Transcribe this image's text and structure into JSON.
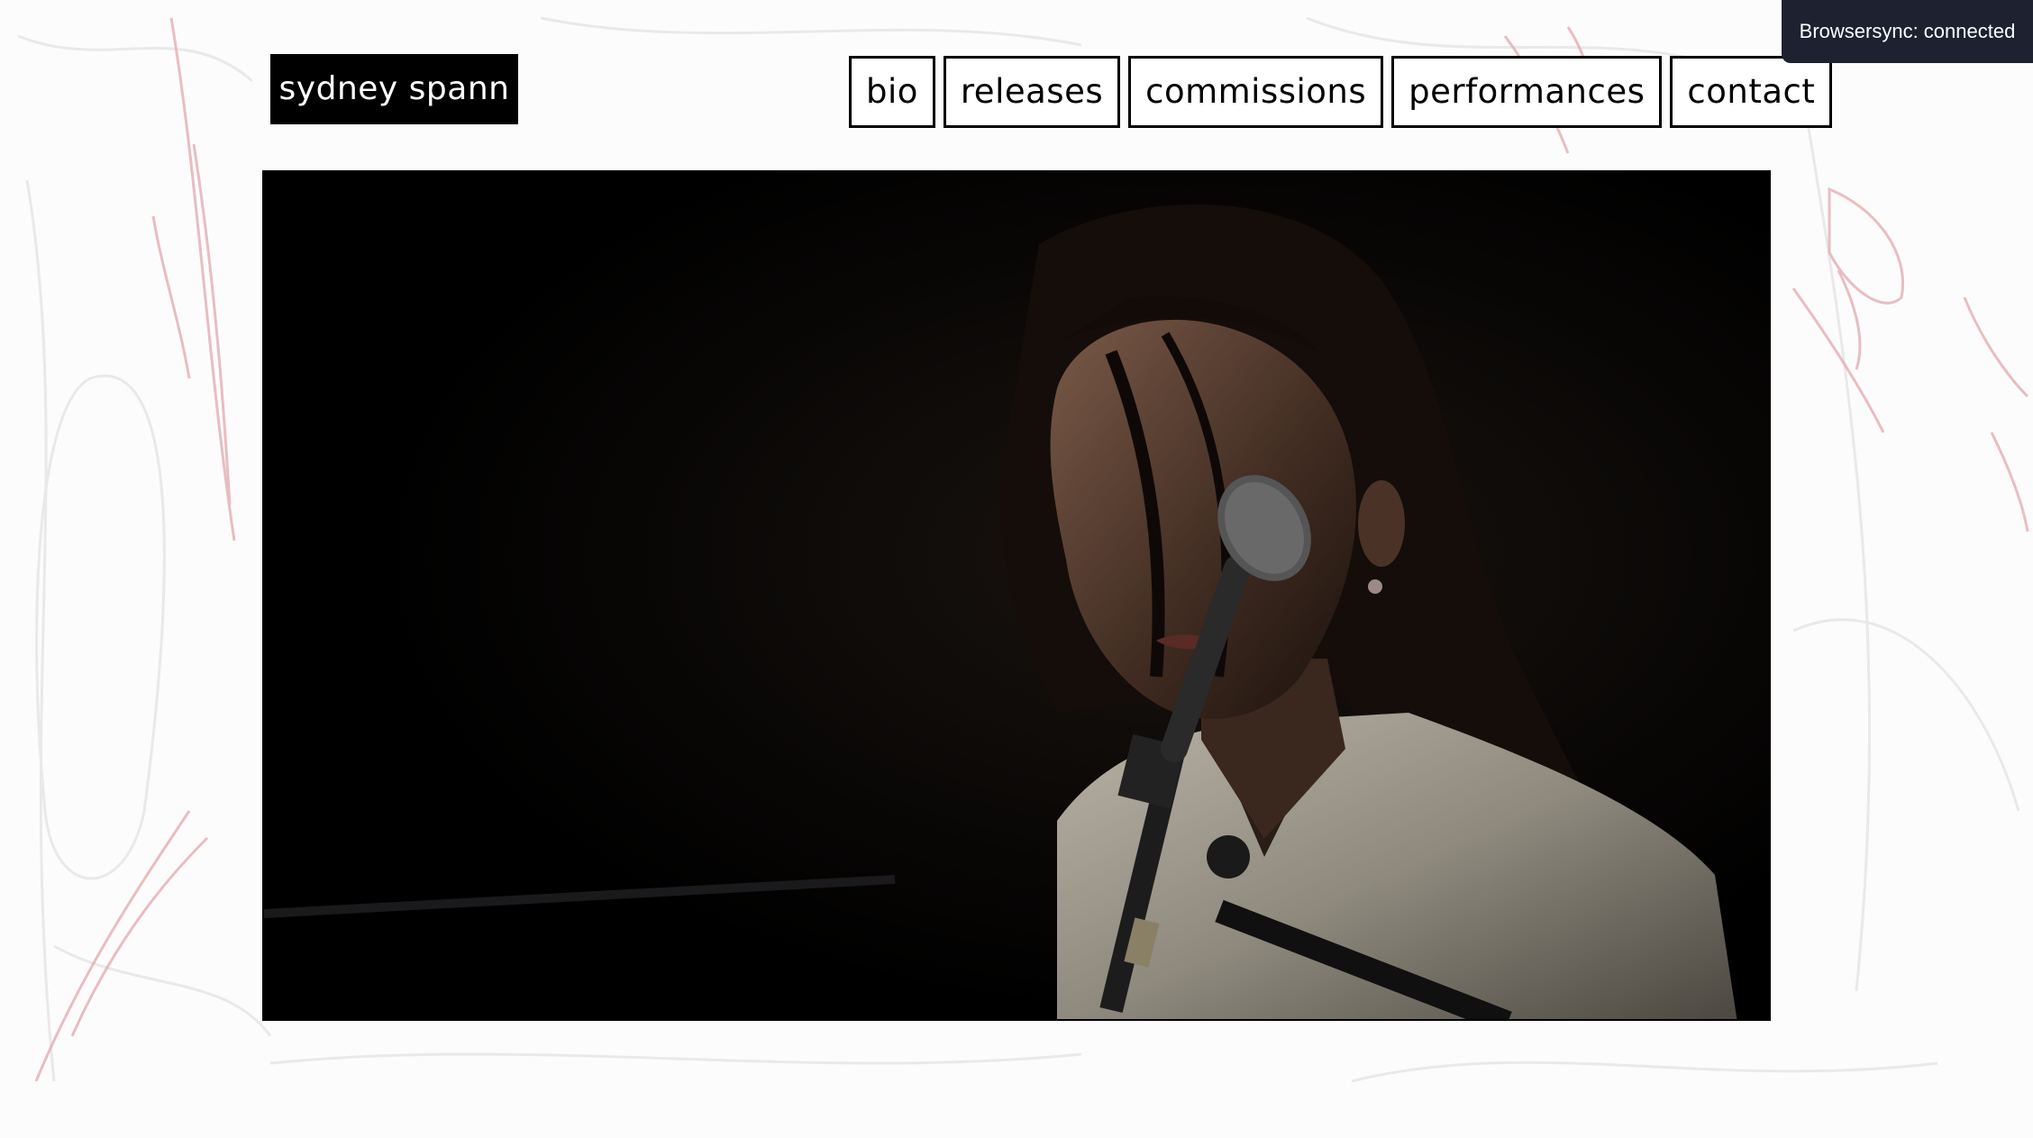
{
  "site": {
    "logo_text": "sydney spann"
  },
  "nav": {
    "items": [
      {
        "label": "bio"
      },
      {
        "label": "releases"
      },
      {
        "label": "commissions"
      },
      {
        "label": "performances"
      },
      {
        "label": "contact"
      }
    ]
  },
  "toast": {
    "text": "Browsersync: connected"
  },
  "colors": {
    "background": "#fdfcfc",
    "sketch_red": "#e0a3a8",
    "sketch_grey": "#e6e6e6",
    "toast_bg": "#1d2130"
  }
}
